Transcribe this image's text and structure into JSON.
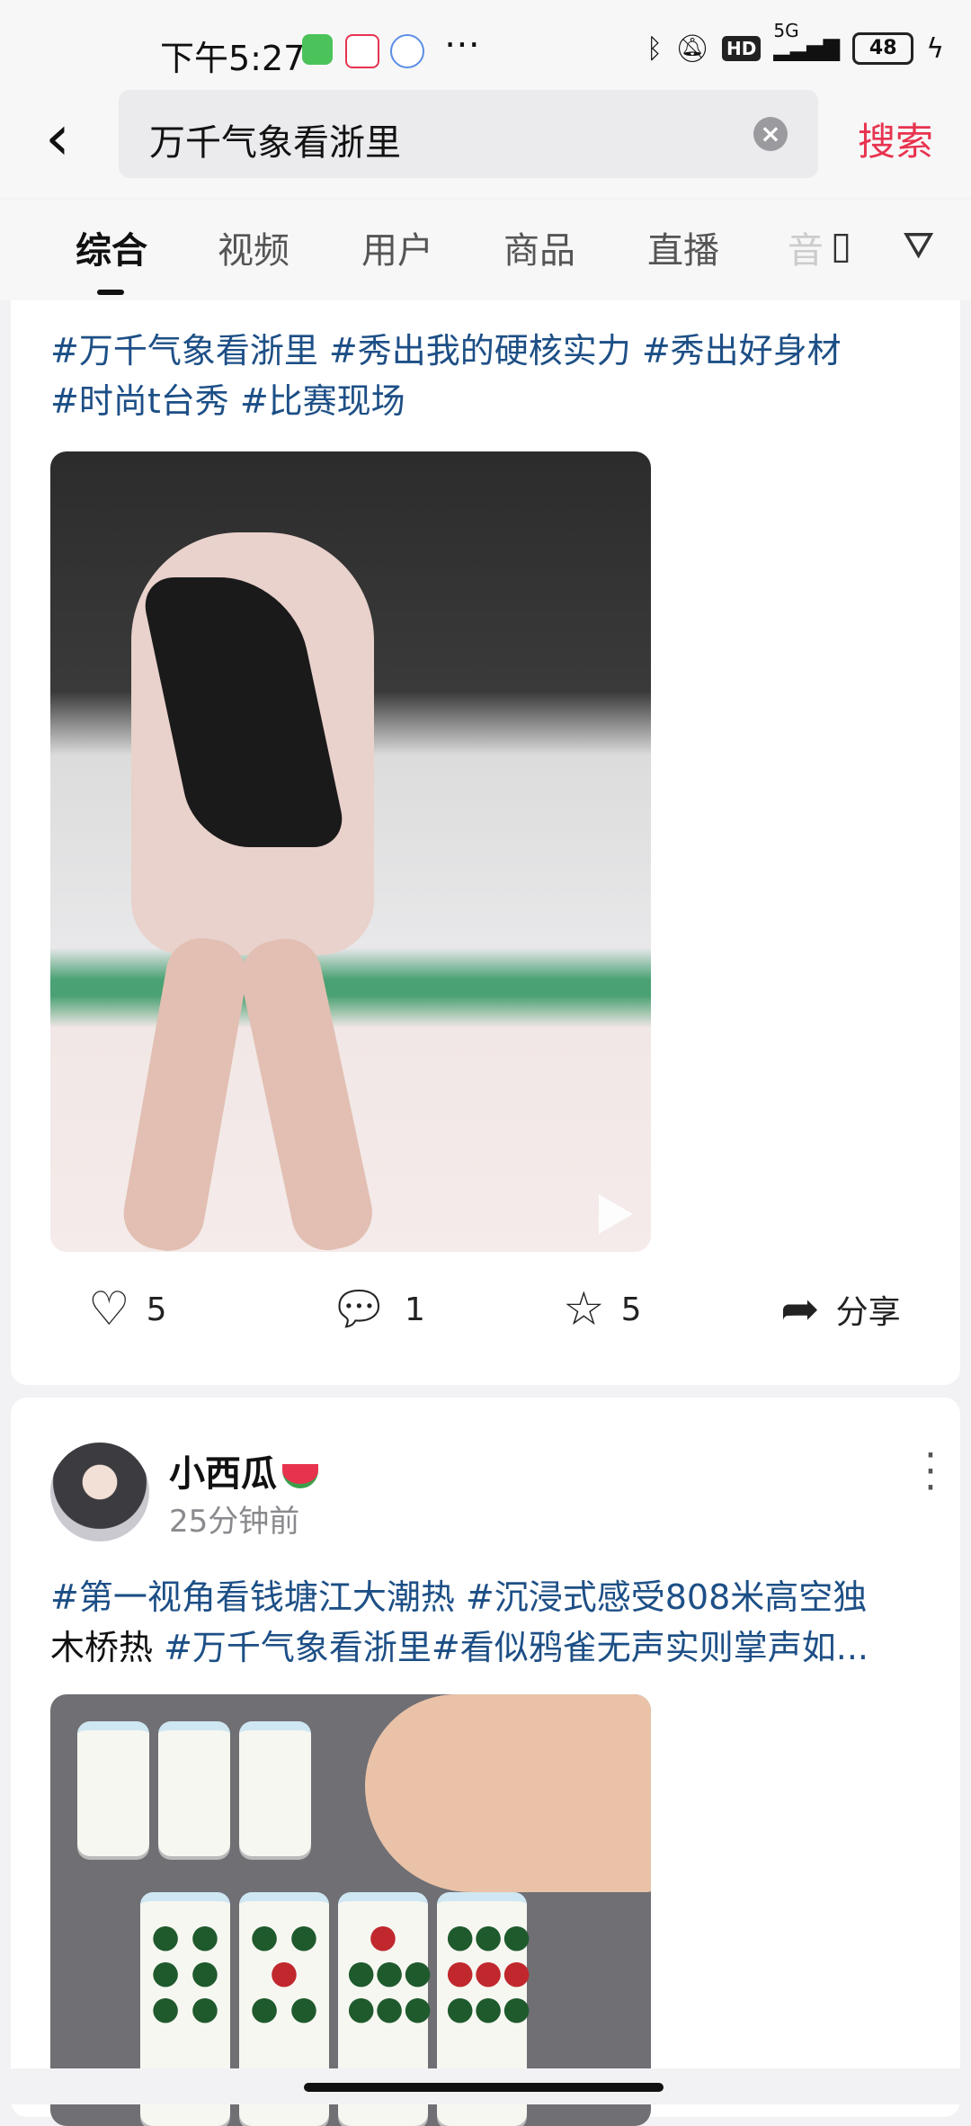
{
  "status_bar": {
    "time": "下午5:27",
    "network": "5G",
    "hd": "HD",
    "battery": "48",
    "icons": [
      "app-icon-green",
      "app-icon-58",
      "app-icon-cloud",
      "more-dots-icon",
      "bluetooth-icon",
      "mute-bell-icon",
      "hd-icon",
      "signal-icon",
      "battery-icon",
      "charging-icon"
    ]
  },
  "header": {
    "back_icon": "chevron-left-icon",
    "search_query": "万千气象看浙里",
    "clear_icon": "clear-circle-icon",
    "search_label": "搜索"
  },
  "tabs": {
    "items": [
      "综合",
      "视频",
      "用户",
      "商品",
      "直播"
    ],
    "partial_item": "音",
    "active_index": 0
  },
  "posts": [
    {
      "hashtags_line1": "#万千气象看浙里 #秀出我的硬核实力 #秀出好身材",
      "hashtags_line2": "#时尚t台秀 #比赛现场",
      "actions": {
        "like_count": "5",
        "comment_count": "1",
        "favorite_count": "5",
        "share_label": "分享"
      }
    },
    {
      "username": "小西瓜",
      "time": "25分钟前",
      "text_line1": "#第一视角看钱塘江大潮热 #沉浸式感受808米高空独",
      "text_line2_plain": "木桥热 ",
      "text_line2_tags": "#万千气象看浙里#看似鸦雀无声实则掌声如..."
    }
  ],
  "colors": {
    "accent": "#e8334f",
    "hashtag": "#1d4f86",
    "background": "#f2f2f4",
    "card": "#ffffff"
  }
}
